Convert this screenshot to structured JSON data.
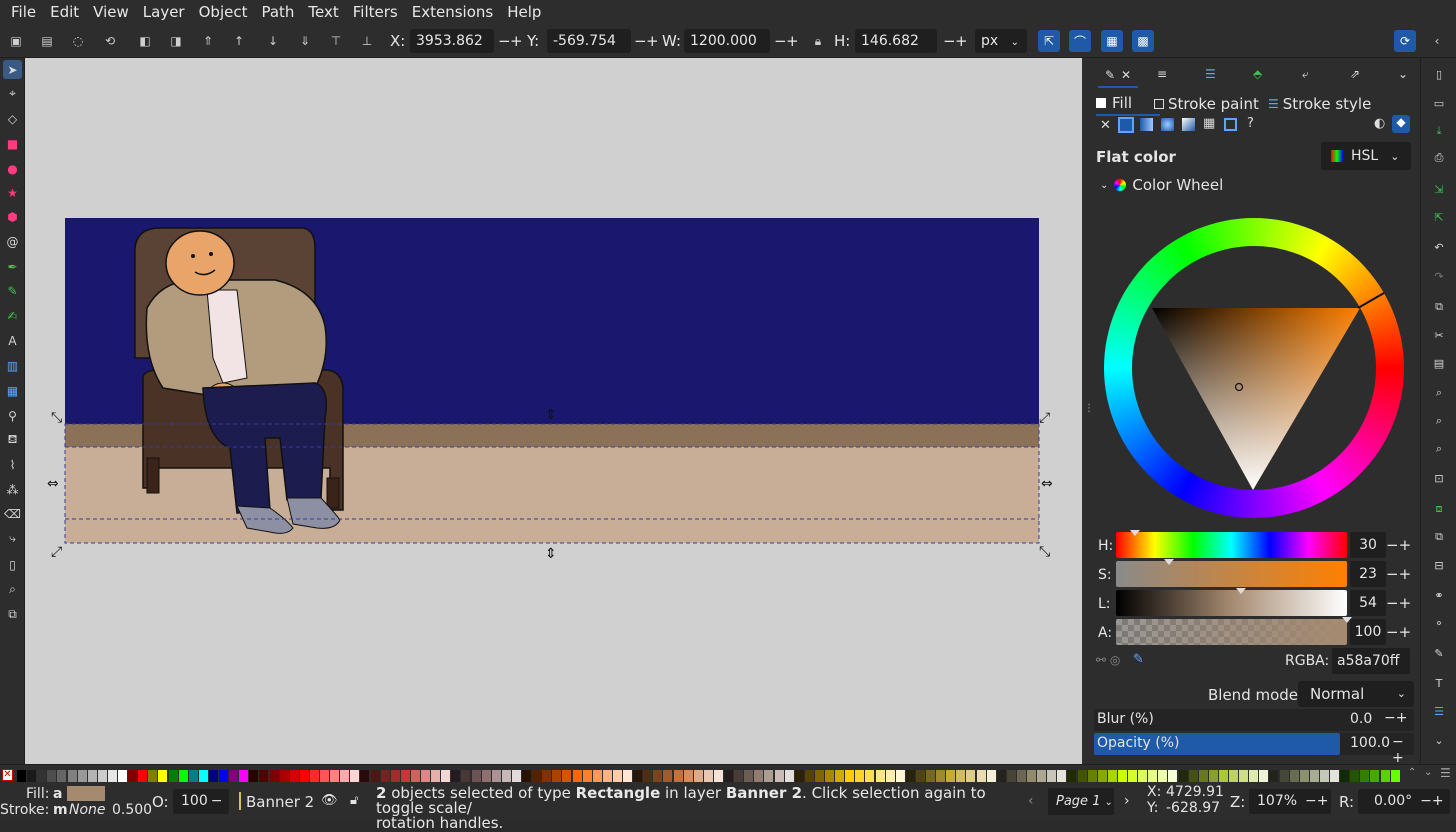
{
  "menu": [
    "File",
    "Edit",
    "View",
    "Layer",
    "Object",
    "Path",
    "Text",
    "Filters",
    "Extensions",
    "Help"
  ],
  "controls": {
    "x_label": "X:",
    "x_value": "3953.862",
    "y_label": "Y:",
    "y_value": "-569.754",
    "w_label": "W:",
    "w_value": "1200.000",
    "h_label": "H:",
    "h_value": "146.682",
    "unit": "px",
    "minus": "−",
    "plus": "+"
  },
  "fill_panel": {
    "tabs": [
      "Fill",
      "Stroke paint",
      "Stroke style"
    ],
    "flat_color": "Flat color",
    "mode": "HSL",
    "color_wheel": "Color Wheel",
    "channels": [
      {
        "label": "H:",
        "value": "30",
        "fraction": 0.083
      },
      {
        "label": "S:",
        "value": "23",
        "fraction": 0.23
      },
      {
        "label": "L:",
        "value": "54",
        "fraction": 0.54
      },
      {
        "label": "A:",
        "value": "100",
        "fraction": 1.0
      }
    ],
    "rgba_label": "RGBA:",
    "rgba_value": "a58a70ff",
    "blend_label": "Blend mode:",
    "blend_value": "Normal",
    "blur_label": "Blur (%)",
    "blur_value": "0.0",
    "opacity_label": "Opacity (%)",
    "opacity_value": "100.0",
    "unknown_btn": "?"
  },
  "status": {
    "fill_label": "Fill:",
    "fill_mode": "a",
    "fill_color": "#a58a70",
    "stroke_label": "Stroke:",
    "stroke_mode": "m",
    "stroke_value": "None",
    "stroke_width": "0.500",
    "opacity_label": "O:",
    "opacity_value": "100",
    "layer": "Banner 2",
    "msg_1": "2",
    "msg_2": " objects selected of type ",
    "msg_3": "Rectangle",
    "msg_4": " in layer ",
    "msg_5": "Banner 2",
    "msg_6": ". Click selection again to toggle scale/",
    "msg_7": "rotation handles.",
    "page": "Page 1",
    "cx_label": "X:",
    "cx_value": "4729.91",
    "cy_label": "Y:",
    "cy_value": "-628.97",
    "zoom_label": "Z:",
    "zoom_value": "107%",
    "rot_label": "R:",
    "rot_value": "0.00°"
  },
  "colors": {
    "accent": "#1e5aa8",
    "banner_sky": "#19176e",
    "stripe_dark": "#8a7158",
    "stripe_light": "#c8ae96",
    "selected_fill": "#a58a70"
  },
  "palette": [
    "#000000",
    "#1a1a1a",
    "#333333",
    "#4d4d4d",
    "#666666",
    "#808080",
    "#999999",
    "#b3b3b3",
    "#cccccc",
    "#e6e6e6",
    "#ffffff",
    "#800000",
    "#ff0000",
    "#808000",
    "#ffff00",
    "#008000",
    "#00ff00",
    "#008080",
    "#00ffff",
    "#000080",
    "#0000ff",
    "#800080",
    "#ff00ff",
    "#2b0000",
    "#550000",
    "#800000",
    "#aa0000",
    "#d40000",
    "#ff0000",
    "#ff2a2a",
    "#ff5555",
    "#ff8080",
    "#ffaaaa",
    "#ffd5d5",
    "#280b0b",
    "#501616",
    "#782121",
    "#a02c2c",
    "#c83737",
    "#d35f5f",
    "#de8787",
    "#e9afaf",
    "#f4d7d7",
    "#241c1c",
    "#483737",
    "#6c5353",
    "#916f6f",
    "#ac9393",
    "#c8b7b7",
    "#e3dbdb",
    "#2b1100",
    "#552200",
    "#803300",
    "#aa4400",
    "#d45500",
    "#ff6600",
    "#ff7f2a",
    "#ff9955",
    "#ffb380",
    "#ffccaa",
    "#ffe6d5",
    "#28170b",
    "#502d16",
    "#784421",
    "#a05a2c",
    "#c87137",
    "#d38d5f",
    "#deaa87",
    "#e9c6af",
    "#f4e3d7",
    "#241f1c",
    "#483e37",
    "#6c5d53",
    "#917c6f",
    "#ac9d93",
    "#c8beb7",
    "#e3dedb",
    "#2b2200",
    "#554400",
    "#806600",
    "#aa8800",
    "#d4aa00",
    "#ffcc00",
    "#ffd42a",
    "#ffdd55",
    "#ffe680",
    "#ffeeaa",
    "#fff6d5",
    "#28220b",
    "#504416",
    "#786721",
    "#a0892c",
    "#c8ab37",
    "#d3bc5f",
    "#decd87",
    "#e9ddaf",
    "#f4eed7",
    "#24221c",
    "#484537",
    "#6c6753",
    "#918a6f",
    "#aca793",
    "#c8c4b7",
    "#e3e2db",
    "#222b00",
    "#445500",
    "#668000",
    "#88aa00",
    "#aad400",
    "#ccff00",
    "#d4ff2a",
    "#ddff55",
    "#e5ff80",
    "#eeffaa",
    "#f6ffd5",
    "#22280b",
    "#445016",
    "#677821",
    "#89a02c",
    "#abc837",
    "#bcd35f",
    "#cdde87",
    "#dde9af",
    "#eef4d7",
    "#22241c",
    "#454837",
    "#676c53",
    "#8a916f",
    "#a7ac93",
    "#c4c8b7",
    "#e2e3db",
    "#112b00",
    "#225500",
    "#338000",
    "#44aa00",
    "#55d400",
    "#66ff00"
  ]
}
